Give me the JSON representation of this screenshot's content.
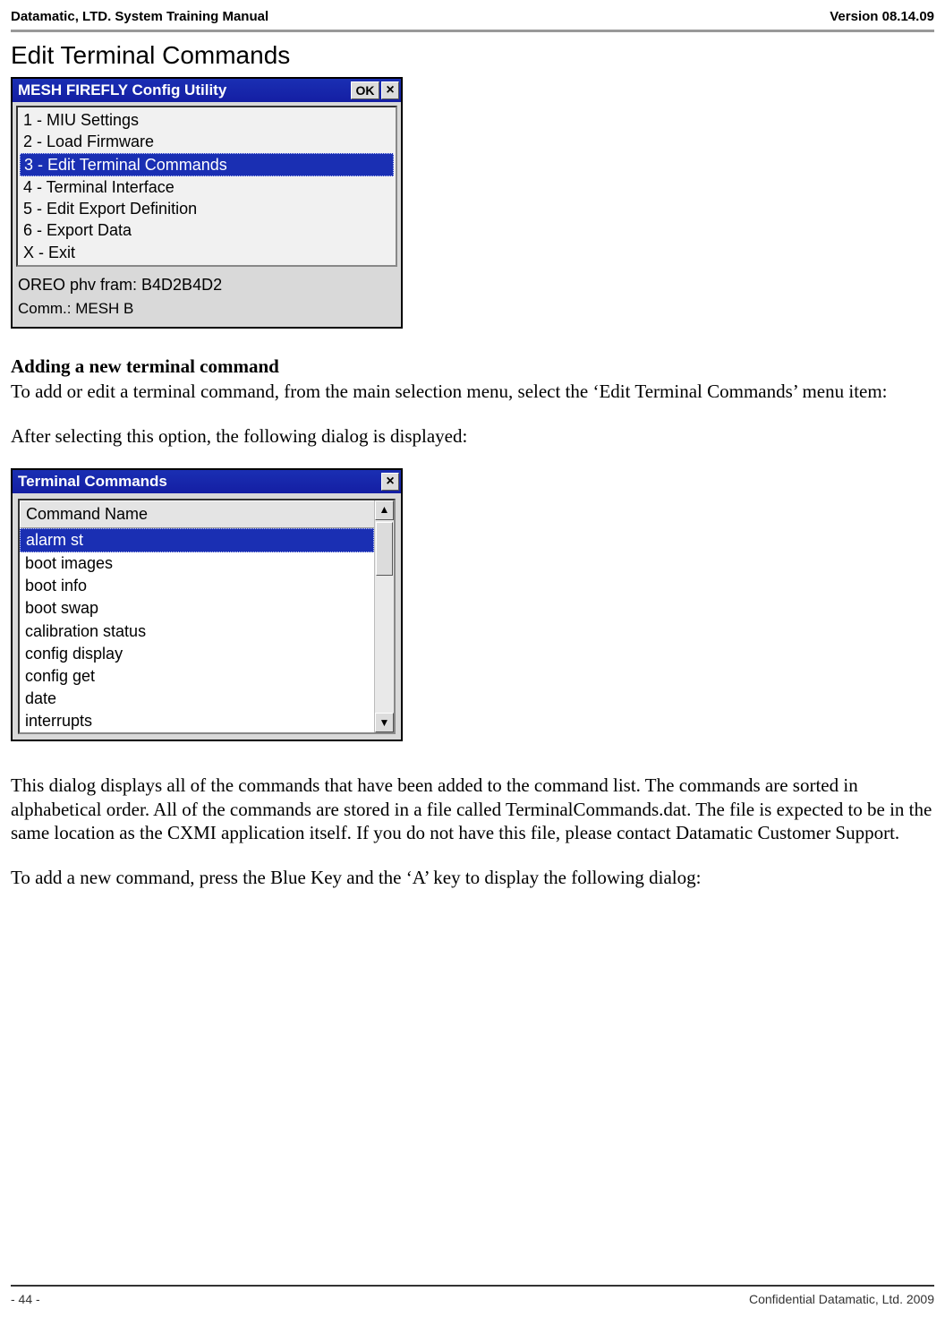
{
  "header": {
    "left": "Datamatic, LTD. System Training  Manual",
    "right": "Version 08.14.09"
  },
  "section_title": "Edit Terminal Commands",
  "window1": {
    "title": "MESH FIREFLY Config Utility",
    "ok_label": "OK",
    "close_glyph": "×",
    "items": [
      "1 - MIU Settings",
      "2 - Load Firmware",
      "3 - Edit Terminal Commands",
      "4 - Terminal Interface",
      "5 - Edit Export Definition",
      "6 - Export Data",
      "X - Exit"
    ],
    "selected_index": 2,
    "status_line1": "OREO phv fram: B4D2B4D2",
    "status_line2": "Comm.: MESH  B"
  },
  "subheading": "Adding a new terminal command",
  "para1": "To add or edit a terminal command, from the main selection menu, select the ‘Edit Terminal Commands’ menu item:",
  "para2": "After selecting this option, the following dialog is displayed:",
  "window2": {
    "title": "Terminal Commands",
    "close_glyph": "×",
    "column_header": "Command Name",
    "rows": [
      "alarm st",
      "boot images",
      "boot info",
      "boot swap",
      "calibration status",
      "config display",
      "config get",
      "date",
      "interrupts"
    ],
    "selected_index": 0,
    "scroll": {
      "up": "▲",
      "down": "▼"
    }
  },
  "para3": "This dialog displays all of the commands that have been added to the command list.  The commands are sorted in alphabetical order.  All of the commands are stored in a file called TerminalCommands.dat. The file is expected to be in the same location as the CXMI application itself.  If you do not have this file, please contact Datamatic Customer Support.",
  "para4": "To add a new command, press the Blue Key and the ‘A’ key to display the following dialog:",
  "footer": {
    "left": "- 44 -",
    "right": "Confidential Datamatic, Ltd. 2009"
  }
}
